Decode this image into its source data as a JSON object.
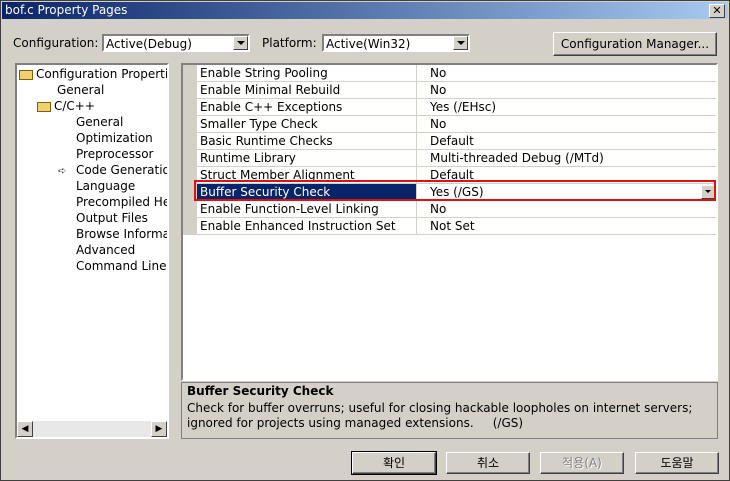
{
  "window": {
    "title": "bof.c Property Pages",
    "close_glyph": "✕"
  },
  "toolbar": {
    "configuration_label": "Configuration:",
    "configuration_value": "Active(Debug)",
    "platform_label": "Platform:",
    "platform_value": "Active(Win32)",
    "config_manager_label": "Configuration Manager..."
  },
  "tree": {
    "items": [
      {
        "label": "Configuration Propertie",
        "icon": "folder-open-icon"
      },
      {
        "label": "General"
      },
      {
        "label": "C/C++",
        "icon": "folder-open-icon"
      },
      {
        "label": "General"
      },
      {
        "label": "Optimization"
      },
      {
        "label": "Preprocessor"
      },
      {
        "label": "Code Generatior",
        "icon": "arrow-icon",
        "selected": true
      },
      {
        "label": "Language"
      },
      {
        "label": "Precompiled He"
      },
      {
        "label": "Output Files"
      },
      {
        "label": "Browse Informat"
      },
      {
        "label": "Advanced"
      },
      {
        "label": "Command Line"
      }
    ],
    "scroll_left": "◀",
    "scroll_right": "▶"
  },
  "properties": {
    "rows": [
      {
        "name": "Enable String Pooling",
        "value": "No"
      },
      {
        "name": "Enable Minimal Rebuild",
        "value": "No"
      },
      {
        "name": "Enable C++ Exceptions",
        "value": "Yes (/EHsc)"
      },
      {
        "name": "Smaller Type Check",
        "value": "No"
      },
      {
        "name": "Basic Runtime Checks",
        "value": "Default"
      },
      {
        "name": "Runtime Library",
        "value": "Multi-threaded Debug (/MTd)"
      },
      {
        "name": "Struct Member Alignment",
        "value": "Default"
      },
      {
        "name": "Buffer Security Check",
        "value": "Yes (/GS)",
        "selected": true
      },
      {
        "name": "Enable Function-Level Linking",
        "value": "No"
      },
      {
        "name": "Enable Enhanced Instruction Set",
        "value": "Not Set"
      }
    ]
  },
  "description": {
    "title": "Buffer Security Check",
    "line1": "Check for buffer overruns; useful for closing hackable loopholes on internet servers;",
    "line2": "ignored for projects using managed extensions.     (/GS)"
  },
  "buttons": {
    "ok": "확인",
    "cancel": "취소",
    "apply": "적용(A)",
    "help": "도움말"
  },
  "colors": {
    "selection": "#0a246a",
    "highlight_box": "#e01010",
    "face": "#d4d0c8"
  }
}
